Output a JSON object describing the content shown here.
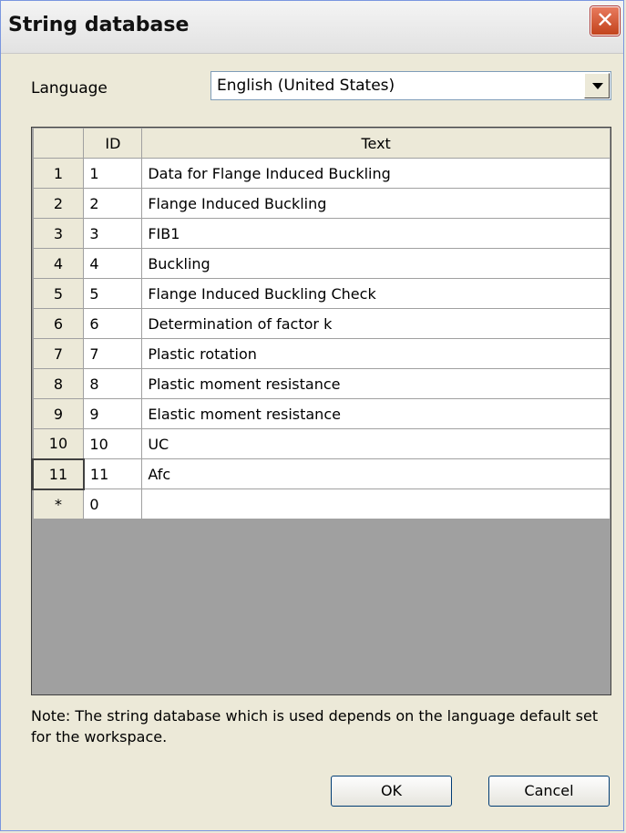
{
  "window": {
    "title": "String database",
    "close_glyph": "✕"
  },
  "language": {
    "label": "Language",
    "selected": "English (United States)"
  },
  "grid": {
    "columns": [
      "ID",
      "Text"
    ],
    "rows": [
      {
        "row": "1",
        "id": "1",
        "text": "Data for Flange Induced Buckling"
      },
      {
        "row": "2",
        "id": "2",
        "text": "Flange Induced Buckling"
      },
      {
        "row": "3",
        "id": "3",
        "text": "FIB1"
      },
      {
        "row": "4",
        "id": "4",
        "text": "Buckling"
      },
      {
        "row": "5",
        "id": "5",
        "text": "Flange Induced Buckling Check"
      },
      {
        "row": "6",
        "id": "6",
        "text": "Determination of factor k"
      },
      {
        "row": "7",
        "id": "7",
        "text": "Plastic rotation"
      },
      {
        "row": "8",
        "id": "8",
        "text": "Plastic moment resistance"
      },
      {
        "row": "9",
        "id": "9",
        "text": "Elastic moment resistance"
      },
      {
        "row": "10",
        "id": "10",
        "text": "UC"
      },
      {
        "row": "11",
        "id": "11",
        "text": "Afc"
      },
      {
        "row": "*",
        "id": "0",
        "text": ""
      }
    ],
    "current_row": "11"
  },
  "note": "Note: The string database which is used depends on the language default set for the workspace.",
  "buttons": {
    "ok": "OK",
    "cancel": "Cancel"
  }
}
